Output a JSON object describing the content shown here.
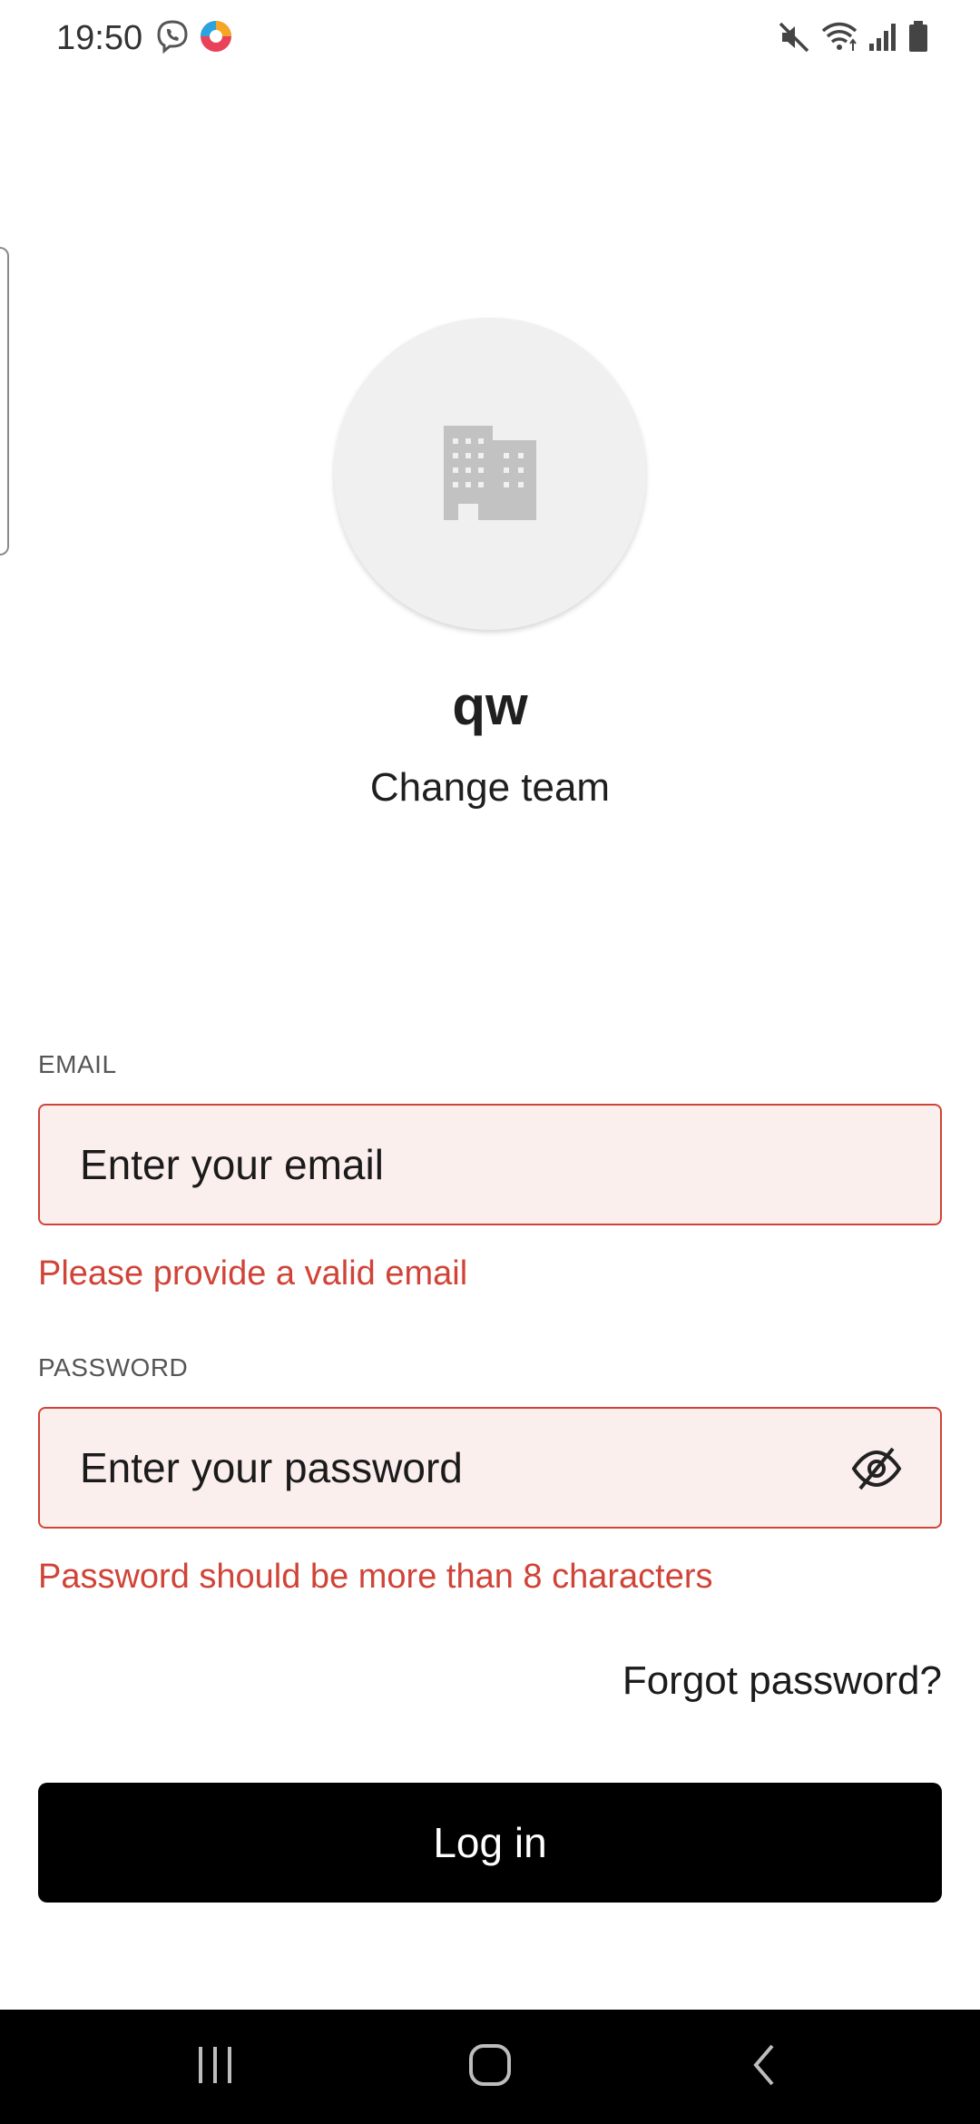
{
  "status_bar": {
    "time": "19:50",
    "left_icons": [
      "viber-icon",
      "app-notification-icon"
    ],
    "right_icons": [
      "mute-icon",
      "wifi-icon",
      "signal-icon",
      "battery-icon"
    ]
  },
  "team": {
    "avatar_icon": "building-icon",
    "name": "qw",
    "change_label": "Change team"
  },
  "form": {
    "email": {
      "label": "EMAIL",
      "placeholder": "Enter your email",
      "value": "",
      "error": "Please provide a valid email"
    },
    "password": {
      "label": "PASSWORD",
      "placeholder": "Enter your password",
      "value": "",
      "error": "Password should be more than 8 characters",
      "toggle_icon": "eye-off-icon"
    },
    "forgot_label": "Forgot password?",
    "login_label": "Log in"
  },
  "nav_bar": {
    "buttons": [
      "recent-apps-icon",
      "home-icon",
      "back-icon"
    ]
  },
  "colors": {
    "error": "#d04438",
    "input_background": "#fbefee",
    "button_background": "#000000",
    "avatar_background": "#f0f0f0"
  }
}
